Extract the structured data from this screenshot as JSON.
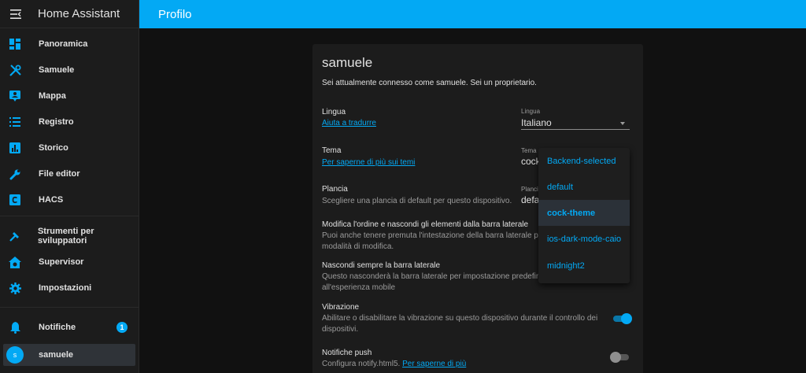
{
  "app": {
    "title": "Home Assistant"
  },
  "topbar": {
    "title": "Profilo"
  },
  "sidebar": {
    "items": [
      {
        "label": "Panoramica",
        "icon": "dashboard-icon"
      },
      {
        "label": "Samuele",
        "icon": "tools-icon"
      },
      {
        "label": "Mappa",
        "icon": "map-icon"
      },
      {
        "label": "Registro",
        "icon": "list-icon"
      },
      {
        "label": "Storico",
        "icon": "chart-icon"
      },
      {
        "label": "File editor",
        "icon": "wrench-icon"
      },
      {
        "label": "HACS",
        "icon": "hacs-icon"
      },
      {
        "label": "Strumenti per sviluppatori",
        "icon": "hammer-icon"
      },
      {
        "label": "Supervisor",
        "icon": "supervisor-icon"
      },
      {
        "label": "Impostazioni",
        "icon": "gear-icon"
      }
    ],
    "notifications": {
      "label": "Notifiche",
      "count": "1"
    },
    "user": {
      "label": "samuele",
      "initial": "s"
    }
  },
  "profile": {
    "title": "samuele",
    "subtitle": "Sei attualmente connesso come samuele. Sei un proprietario.",
    "language": {
      "heading": "Lingua",
      "link": "Aiuta a tradurre",
      "select_label": "Lingua",
      "select_value": "Italiano"
    },
    "theme": {
      "heading": "Tema",
      "link": "Per saperne di più sui temi",
      "select_label": "Tema",
      "select_value": "cock"
    },
    "dashboard": {
      "heading": "Plancia",
      "desc": "Scegliere una plancia di default per questo dispositivo.",
      "select_label": "Plancia",
      "select_value": "defa"
    },
    "sidebar_order": {
      "heading": "Modifica l'ordine e nascondi gli elementi dalla barra laterale",
      "desc1": "Puoi anche tenere premuta l'intestazione della barra laterale per a",
      "desc2": "modalità di modifica."
    },
    "hide_sidebar": {
      "heading": "Nascondi sempre la barra laterale",
      "desc1": "Questo nasconderà la barra laterale per impostazione predefinita",
      "desc2": "all'esperienza mobile"
    },
    "vibration": {
      "heading": "Vibrazione",
      "desc1": "Abilitare o disabilitare la vibrazione su questo dispositivo durante il controllo dei",
      "desc2": "dispositivi.",
      "enabled": true
    },
    "push": {
      "heading": "Notifiche push",
      "desc": "Configura notify.html5.",
      "link": "Per saperne di più",
      "enabled": false
    }
  },
  "theme_dropdown": {
    "options": [
      "Backend-selected",
      "default",
      "cock-theme",
      "ios-dark-mode-caio",
      "midnight2"
    ],
    "selected": "cock-theme"
  },
  "colors": {
    "accent": "#03a9f4",
    "sidebar_bg": "#1c1c1c",
    "page_bg": "#111111"
  }
}
